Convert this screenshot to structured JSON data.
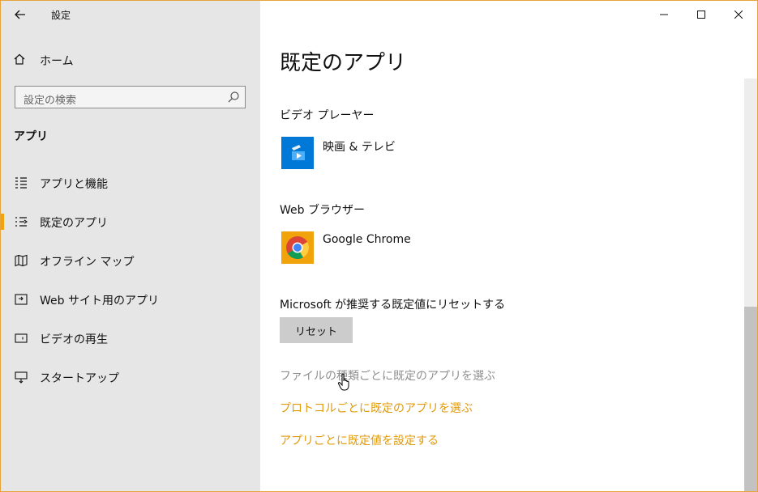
{
  "window": {
    "title": "設定",
    "accent_color": "#f0a30a"
  },
  "sidebar": {
    "home_label": "ホーム",
    "search_placeholder": "設定の検索",
    "section": "アプリ",
    "items": [
      {
        "label": "アプリと機能",
        "icon": "apps-features-icon",
        "selected": false
      },
      {
        "label": "既定のアプリ",
        "icon": "default-apps-icon",
        "selected": true
      },
      {
        "label": "オフライン マップ",
        "icon": "offline-map-icon",
        "selected": false
      },
      {
        "label": "Web サイト用のアプリ",
        "icon": "apps-for-websites-icon",
        "selected": false
      },
      {
        "label": "ビデオの再生",
        "icon": "video-playback-icon",
        "selected": false
      },
      {
        "label": "スタートアップ",
        "icon": "startup-icon",
        "selected": false
      }
    ]
  },
  "main": {
    "title": "既定のアプリ",
    "video_player": {
      "label": "ビデオ プレーヤー",
      "app": "映画 & テレビ",
      "app_color": "#0078d7"
    },
    "web_browser": {
      "label": "Web ブラウザー",
      "app": "Google Chrome",
      "app_color": "#f0a30a"
    },
    "reset": {
      "label": "Microsoft が推奨する既定値にリセットする",
      "button": "リセット"
    },
    "links": [
      "ファイルの種類ごとに既定のアプリを選ぶ",
      "プロトコルごとに既定のアプリを選ぶ",
      "アプリごとに既定値を設定する"
    ]
  }
}
